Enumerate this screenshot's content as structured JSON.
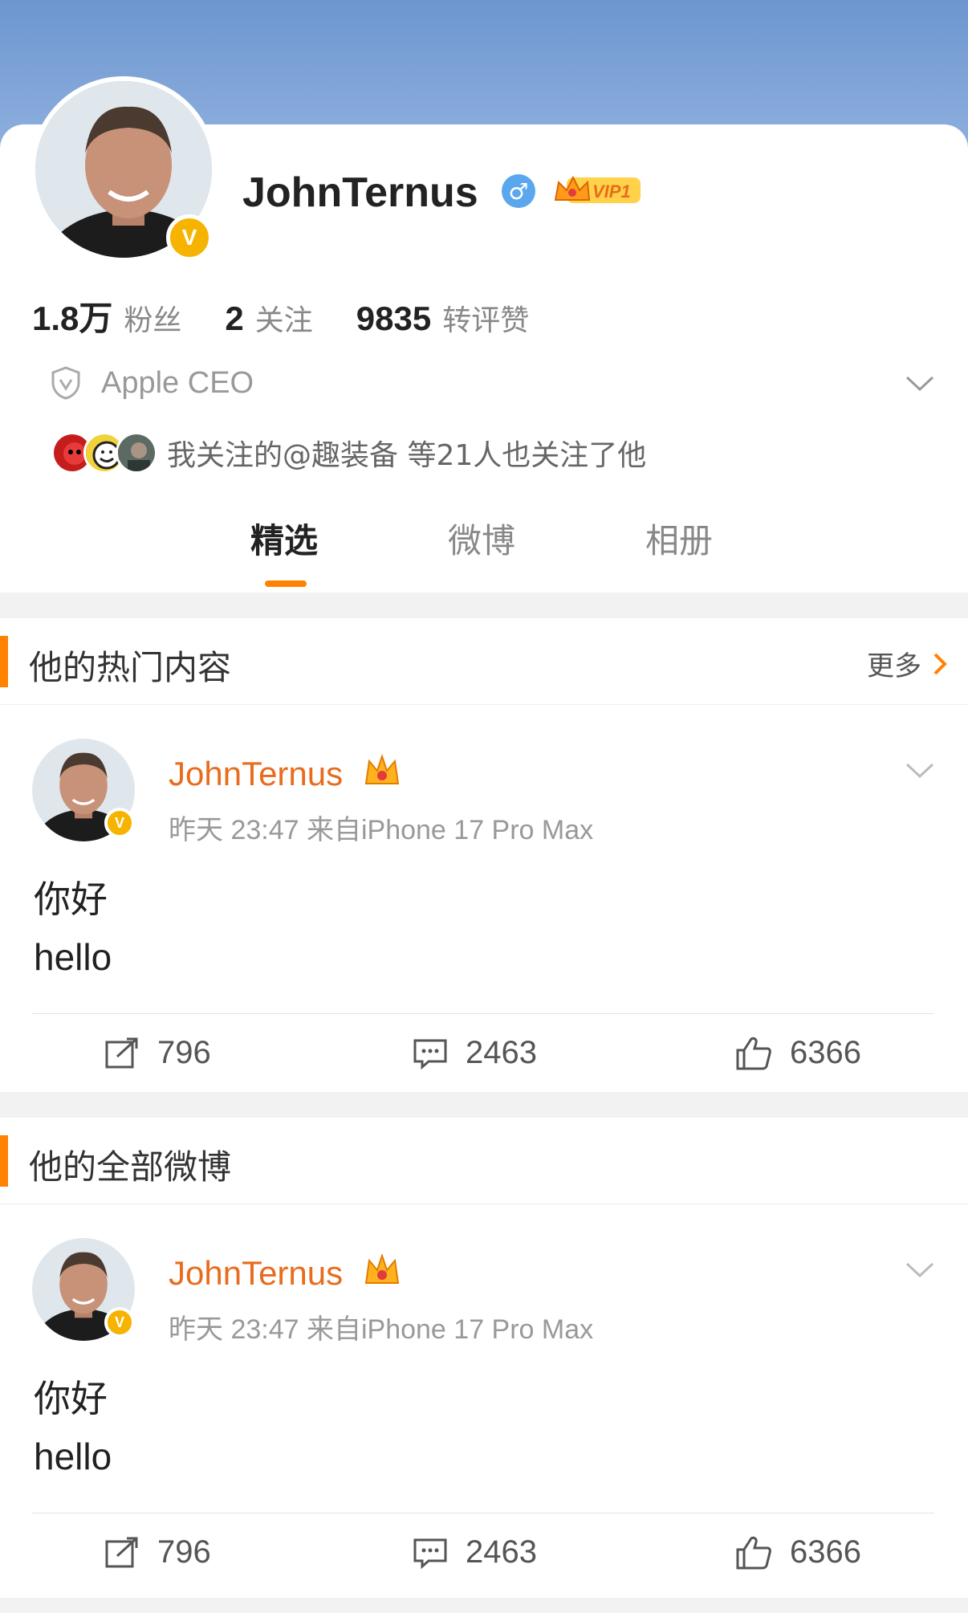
{
  "profile": {
    "username": "JohnTernus",
    "gender_icon": "male-icon",
    "vip_label": "VIP1",
    "verified_badge": "V",
    "stats": [
      {
        "num": "1.8万",
        "label": "粉丝"
      },
      {
        "num": "2",
        "label": "关注"
      },
      {
        "num": "9835",
        "label": "转评赞"
      }
    ],
    "bio": "Apple CEO",
    "mutual_text": "我关注的@趣装备 等21人也关注了他"
  },
  "tabs": [
    {
      "label": "精选",
      "active": true
    },
    {
      "label": "微博",
      "active": false
    },
    {
      "label": "相册",
      "active": false
    }
  ],
  "sections": [
    {
      "title": "他的热门内容",
      "more_label": "更多",
      "post": {
        "author": "JohnTernus",
        "meta": "昨天 23:47  来自iPhone 17 Pro Max",
        "text_line1": "你好",
        "text_line2": "hello",
        "reposts": "796",
        "comments": "2463",
        "likes": "6366"
      }
    },
    {
      "title": "他的全部微博",
      "post": {
        "author": "JohnTernus",
        "meta": "昨天 23:47  来自iPhone 17 Pro Max",
        "text_line1": "你好",
        "text_line2": "hello",
        "reposts": "796",
        "comments": "2463",
        "likes": "6366"
      }
    }
  ],
  "colors": {
    "accent": "#ff8200",
    "name_orange": "#e86c1c",
    "verified": "#f6b400",
    "cover_top": "#6d96cf"
  }
}
